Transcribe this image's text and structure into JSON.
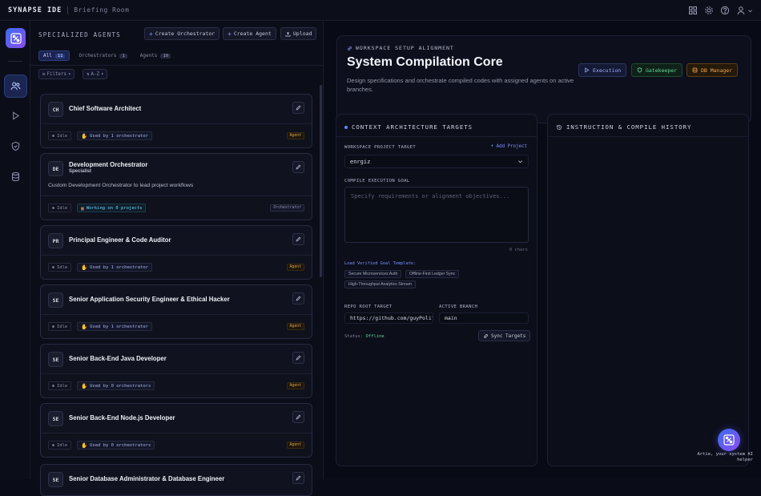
{
  "app": {
    "name": "SYNAPSE IDE",
    "breadcrumb": "Briefing Room"
  },
  "top_icons": [
    "grid-icon",
    "gear-icon",
    "help-icon",
    "user-icon"
  ],
  "rail": [
    "logo-icon",
    "agents-icon",
    "run-icon",
    "shield-icon",
    "database-icon"
  ],
  "agents_panel": {
    "title": "SPECIALIZED AGENTS",
    "create_orchestrator": "Create Orchestrator",
    "create_agent": "Create Agent",
    "upload": "Upload",
    "tabs": [
      {
        "label": "All",
        "count": "11",
        "active": true
      },
      {
        "label": "Orchestrators",
        "count": "1"
      },
      {
        "label": "Agents",
        "count": "10"
      }
    ],
    "filters_label": "Filters",
    "sort_label": "A-Z"
  },
  "agents": [
    {
      "initials": "CH",
      "name": "Chief Software Architect",
      "role": "",
      "desc": "",
      "status": "Idle",
      "usage": "Used by 1 orchestrator",
      "type": "Agent"
    },
    {
      "initials": "DE",
      "name": "Development Orchestrator",
      "role": "Specialist",
      "desc": "Custom Development Orchestrator to lead project workflows",
      "status": "Idle",
      "usage": "Working on 0 projects",
      "type": "Orchestrator"
    },
    {
      "initials": "PR",
      "name": "Principal Engineer & Code Auditor",
      "role": "",
      "desc": "",
      "status": "Idle",
      "usage": "Used by 1 orchestrator",
      "type": "Agent"
    },
    {
      "initials": "SE",
      "name": "Senior Application Security Engineer & Ethical Hacker",
      "role": "",
      "desc": "",
      "status": "Idle",
      "usage": "Used by 1 orchestrator",
      "type": "Agent"
    },
    {
      "initials": "SE",
      "name": "Senior Back-End Java Developer",
      "role": "",
      "desc": "",
      "status": "Idle",
      "usage": "Used by 0 orchestrators",
      "type": "Agent"
    },
    {
      "initials": "SE",
      "name": "Senior Back-End Node.js Developer",
      "role": "",
      "desc": "",
      "status": "Idle",
      "usage": "Used by 0 orchestrators",
      "type": "Agent"
    },
    {
      "initials": "SE",
      "name": "Senior Database Administrator & Database Engineer",
      "role": "",
      "desc": "",
      "status": "Idle",
      "usage": "",
      "type": ""
    }
  ],
  "hero": {
    "kicker": "WORKSPACE SETUP ALIGNMENT",
    "title": "System Compilation Core",
    "subtitle": "Design specifications and orchestrate compiled codes with assigned agents on active branches.",
    "btn_execution": "Execution",
    "btn_gatekeeper": "Gatekeeper",
    "btn_db": "DB Manager"
  },
  "context": {
    "title": "CONTEXT ARCHITECTURE TARGETS",
    "project_label": "WORKSPACE PROJECT TARGET",
    "add_project": "+ Add Project",
    "project_value": "enrgiz",
    "goal_label": "COMPILE EXECUTION GOAL",
    "goal_placeholder": "Specify requirements or alignment objectives...",
    "chars": "0 chars",
    "template_label": "Load Verified Goal Template:",
    "templates": [
      "Secure Microservices Auth",
      "Offline-First Ledger Sync",
      "High-Throughput Analytics Stream"
    ],
    "repo_label": "REPO ROOT TARGET",
    "repo_value": "https://github.com/guyPolitzer",
    "branch_label": "ACTIVE BRANCH",
    "branch_value": "main",
    "status_label": "Status:",
    "status_value": "Offline",
    "sync_label": "Sync Targets"
  },
  "history": {
    "title": "INSTRUCTION & COMPILE HISTORY"
  },
  "helper": {
    "text": "Artie, your system AI helper"
  },
  "colors": {
    "accent": "#6b80f0",
    "success": "#68d79a",
    "warning": "#f0a54d",
    "background": "#0a0c18"
  }
}
